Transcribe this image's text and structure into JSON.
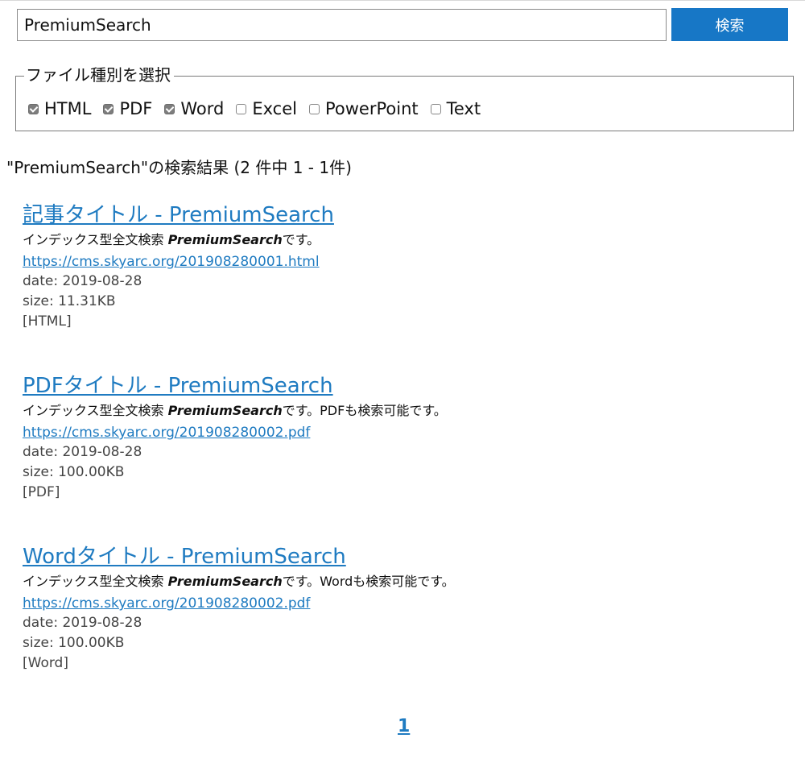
{
  "search": {
    "query": "PremiumSearch",
    "button_label": "検索"
  },
  "filetype": {
    "legend": "ファイル種別を選択",
    "options": [
      {
        "label": "HTML",
        "checked": true
      },
      {
        "label": "PDF",
        "checked": true
      },
      {
        "label": "Word",
        "checked": true
      },
      {
        "label": "Excel",
        "checked": false
      },
      {
        "label": "PowerPoint",
        "checked": false
      },
      {
        "label": "Text",
        "checked": false
      }
    ]
  },
  "results_heading": "\"PremiumSearch\"の検索結果 (2 件中 1 - 1件)",
  "results": [
    {
      "title": "記事タイトル - PremiumSearch",
      "snippet_prefix": "インデックス型全文検索 ",
      "snippet_highlight": "PremiumSearch",
      "snippet_suffix": "です。",
      "url": "https://cms.skyarc.org/201908280001.html",
      "date": "date: 2019-08-28",
      "size": "size: 11.31KB",
      "type": "[HTML]"
    },
    {
      "title": "PDFタイトル - PremiumSearch",
      "snippet_prefix": "インデックス型全文検索 ",
      "snippet_highlight": "PremiumSearch",
      "snippet_suffix": "です。PDFも検索可能です。",
      "url": "https://cms.skyarc.org/201908280002.pdf",
      "date": "date: 2019-08-28",
      "size": "size: 100.00KB",
      "type": "[PDF]"
    },
    {
      "title": "Wordタイトル - PremiumSearch",
      "snippet_prefix": "インデックス型全文検索 ",
      "snippet_highlight": "PremiumSearch",
      "snippet_suffix": "です。Wordも検索可能です。",
      "url": "https://cms.skyarc.org/201908280002.pdf",
      "date": "date: 2019-08-28",
      "size": "size: 100.00KB",
      "type": "[Word]"
    }
  ],
  "pagination": {
    "pages": [
      "1"
    ]
  }
}
